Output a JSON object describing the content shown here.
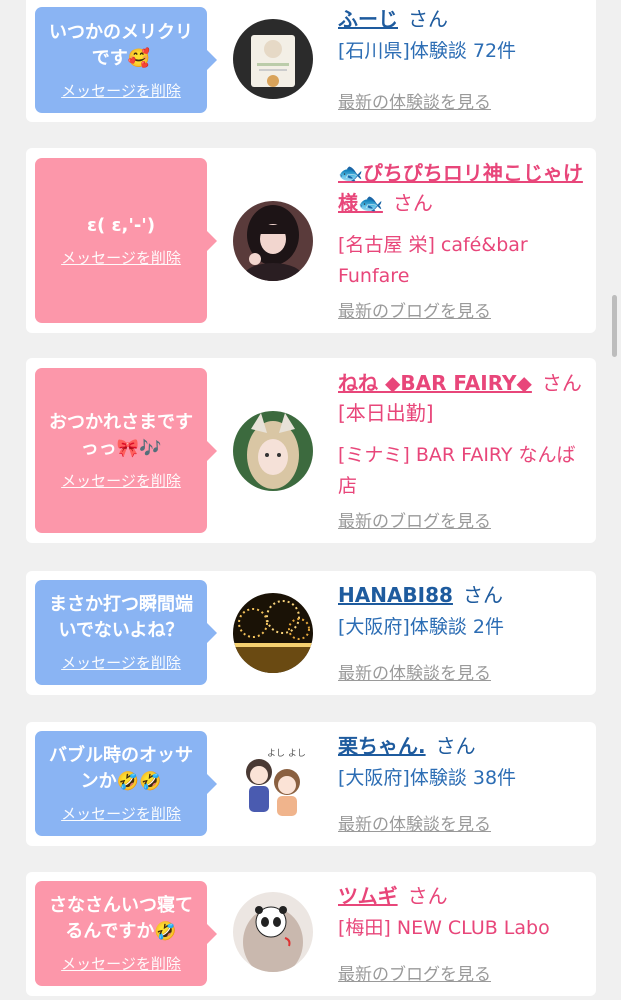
{
  "items": [
    {
      "bubble_color": "blue",
      "message": "いつかのメリクリです🥰",
      "delete_label": "メッセージを削除",
      "name": "ふーじ",
      "honorific": "さん",
      "detail": "[石川県]体験談 72件",
      "more_label": "最新の体験談を見る",
      "avatar_icon": "cat-card-avatar"
    },
    {
      "bubble_color": "pink",
      "message": "ε( ε,'-')",
      "delete_label": "メッセージを削除",
      "name": "🐟ぴちぴちロリ神こじゃけ様🐟",
      "honorific": "さん",
      "detail": "[名古屋 栄] café&bar Funfare",
      "more_label": "最新のブログを見る",
      "avatar_icon": "girl-photo-avatar"
    },
    {
      "bubble_color": "pink",
      "message": "おつかれさまですっっ🎀🎶",
      "delete_label": "メッセージを削除",
      "name": "ねね ◆BAR FAIRY◆",
      "honorific": "さん",
      "name_suffix": "[本日出勤]",
      "detail": "[ミナミ] BAR FAIRY なんば店",
      "more_label": "最新のブログを見る",
      "avatar_icon": "girl-cat-filter-avatar"
    },
    {
      "bubble_color": "blue",
      "message": "まさか打つ瞬間端いでないよね？",
      "delete_label": "メッセージを削除",
      "name": "HANABI88",
      "honorific": "さん",
      "detail": "[大阪府]体験談 2件",
      "more_label": "最新の体験談を見る",
      "avatar_icon": "fireworks-avatar"
    },
    {
      "bubble_color": "blue",
      "message": "バブル時のオッサンか🤣🤣",
      "delete_label": "メッセージを削除",
      "name": "栗ちゃん.",
      "honorific": "さん",
      "detail": "[大阪府]体験談 38件",
      "more_label": "最新の体験談を見る",
      "avatar_icon": "cartoon-couple-avatar",
      "avatar_text": "よし よし"
    },
    {
      "bubble_color": "pink",
      "message": "さなさんいつ寝てるんですか🤣",
      "delete_label": "メッセージを削除",
      "name": "ツムギ",
      "honorific": "さん",
      "detail": "[梅田] NEW CLUB Labo",
      "more_label": "最新のブログを見る",
      "avatar_icon": "panda-face-avatar"
    }
  ],
  "colors": {
    "blue_bubble": "#8ab4f3",
    "pink_bubble": "#fc97aa",
    "blue_text": "#1e5b9e",
    "pink_text": "#e8467a",
    "link_gray": "#9a9a9a",
    "background": "#f0f0f0"
  }
}
